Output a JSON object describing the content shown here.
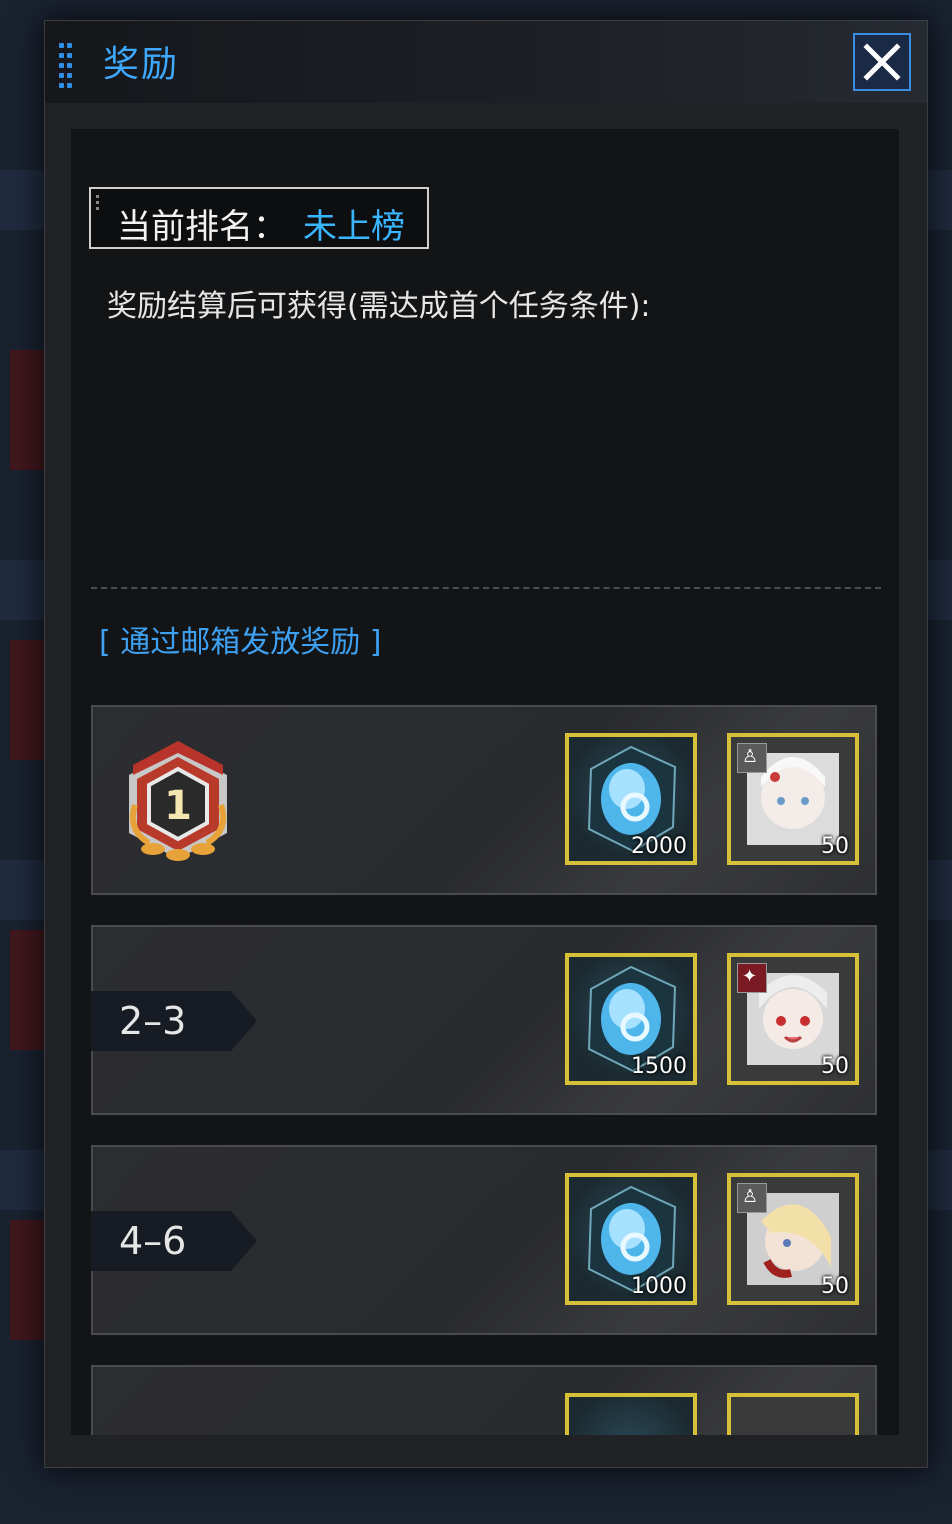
{
  "dialog": {
    "title": "奖励",
    "close_label": "×"
  },
  "rank": {
    "label": "当前排名：",
    "value": "未上榜"
  },
  "description": "奖励结算后可获得(需达成首个任务条件):",
  "mail_label": "[ 通过邮箱发放奖励 ]",
  "colors": {
    "accent_blue": "#3ea8ff",
    "item_border_gold": "#d6c037",
    "panel_bg": "#131416"
  },
  "reward_rows": [
    {
      "rank": "1",
      "rank_display": "badge",
      "rewards": [
        {
          "icon": "gem-icon",
          "count": "2000"
        },
        {
          "icon": "character-piece-icon",
          "count": "50"
        }
      ]
    },
    {
      "rank": "2–3",
      "rank_display": "tag",
      "rewards": [
        {
          "icon": "gem-icon",
          "count": "1500"
        },
        {
          "icon": "character-piece-icon",
          "count": "50"
        }
      ]
    },
    {
      "rank": "4–6",
      "rank_display": "tag",
      "rewards": [
        {
          "icon": "gem-icon",
          "count": "1000"
        },
        {
          "icon": "character-piece-icon",
          "count": "50"
        }
      ]
    }
  ]
}
